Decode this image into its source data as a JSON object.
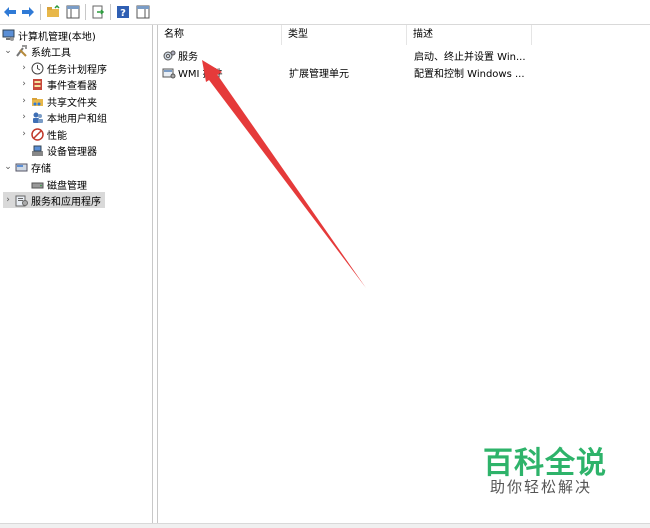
{
  "toolbar": {
    "buttons": [
      {
        "icon": "back-arrow-icon"
      },
      {
        "icon": "forward-arrow-icon"
      },
      {
        "icon": "up-folder-icon"
      },
      {
        "icon": "show-hide-console-tree-icon"
      },
      {
        "icon": "export-list-icon"
      },
      {
        "icon": "help-icon"
      },
      {
        "icon": "show-hide-action-pane-icon"
      }
    ]
  },
  "tree": {
    "root": "计算机管理(本地)",
    "system_tools": "系统工具",
    "task_scheduler": "任务计划程序",
    "event_viewer": "事件查看器",
    "shared_folders": "共享文件夹",
    "local_users": "本地用户和组",
    "performance": "性能",
    "device_manager": "设备管理器",
    "storage": "存储",
    "disk_management": "磁盘管理",
    "services_apps": "服务和应用程序"
  },
  "list": {
    "columns": [
      "名称",
      "类型",
      "描述"
    ],
    "rows": [
      {
        "name": "服务",
        "type": "",
        "desc": "启动、终止并设置 Win..."
      },
      {
        "name": "WMI 控件",
        "type": "扩展管理单元",
        "desc": "配置和控制 Windows ..."
      }
    ]
  },
  "watermark": {
    "title": "百科全说",
    "subtitle": "助你轻松解决"
  },
  "colors": {
    "arrow": "#e53a3a",
    "watermark_green": "#2eb36a",
    "selected_row": "#d9d9d9"
  }
}
